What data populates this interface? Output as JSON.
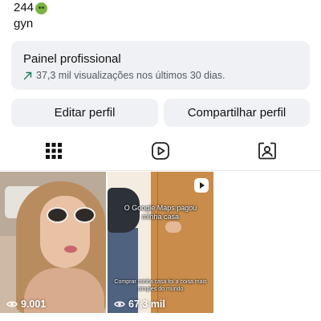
{
  "profile": {
    "bio_line1": "244",
    "bio_emoji": "nauseated-face-emoji",
    "bio_line2": "gyn"
  },
  "panel": {
    "title": "Painel profissional",
    "subtitle": "37,3 mil visualizações nos últimos 30 dias.",
    "trend_icon": "arrow-up-right-icon",
    "trend_color": "#1a7f5a"
  },
  "buttons": {
    "edit": "Editar perfil",
    "share": "Compartilhar perfil"
  },
  "tabs": [
    {
      "name": "grid",
      "icon": "grid-icon",
      "active": true
    },
    {
      "name": "reels",
      "icon": "reels-icon",
      "active": false
    },
    {
      "name": "tagged",
      "icon": "tagged-user-icon",
      "active": false
    }
  ],
  "posts": [
    {
      "views": "9.001",
      "icon": "eye-icon"
    },
    {
      "views": "67,3 mil",
      "icon": "eye-icon",
      "caption_top": "O Google Maps pagou minha casa",
      "caption_bottom": "Comprar minha casa foi a coisa mais simples do mundo"
    }
  ],
  "colors": {
    "panel_bg": "#eff1f4",
    "button_bg": "#eff1f4",
    "text": "#111111",
    "muted": "#555b63"
  }
}
